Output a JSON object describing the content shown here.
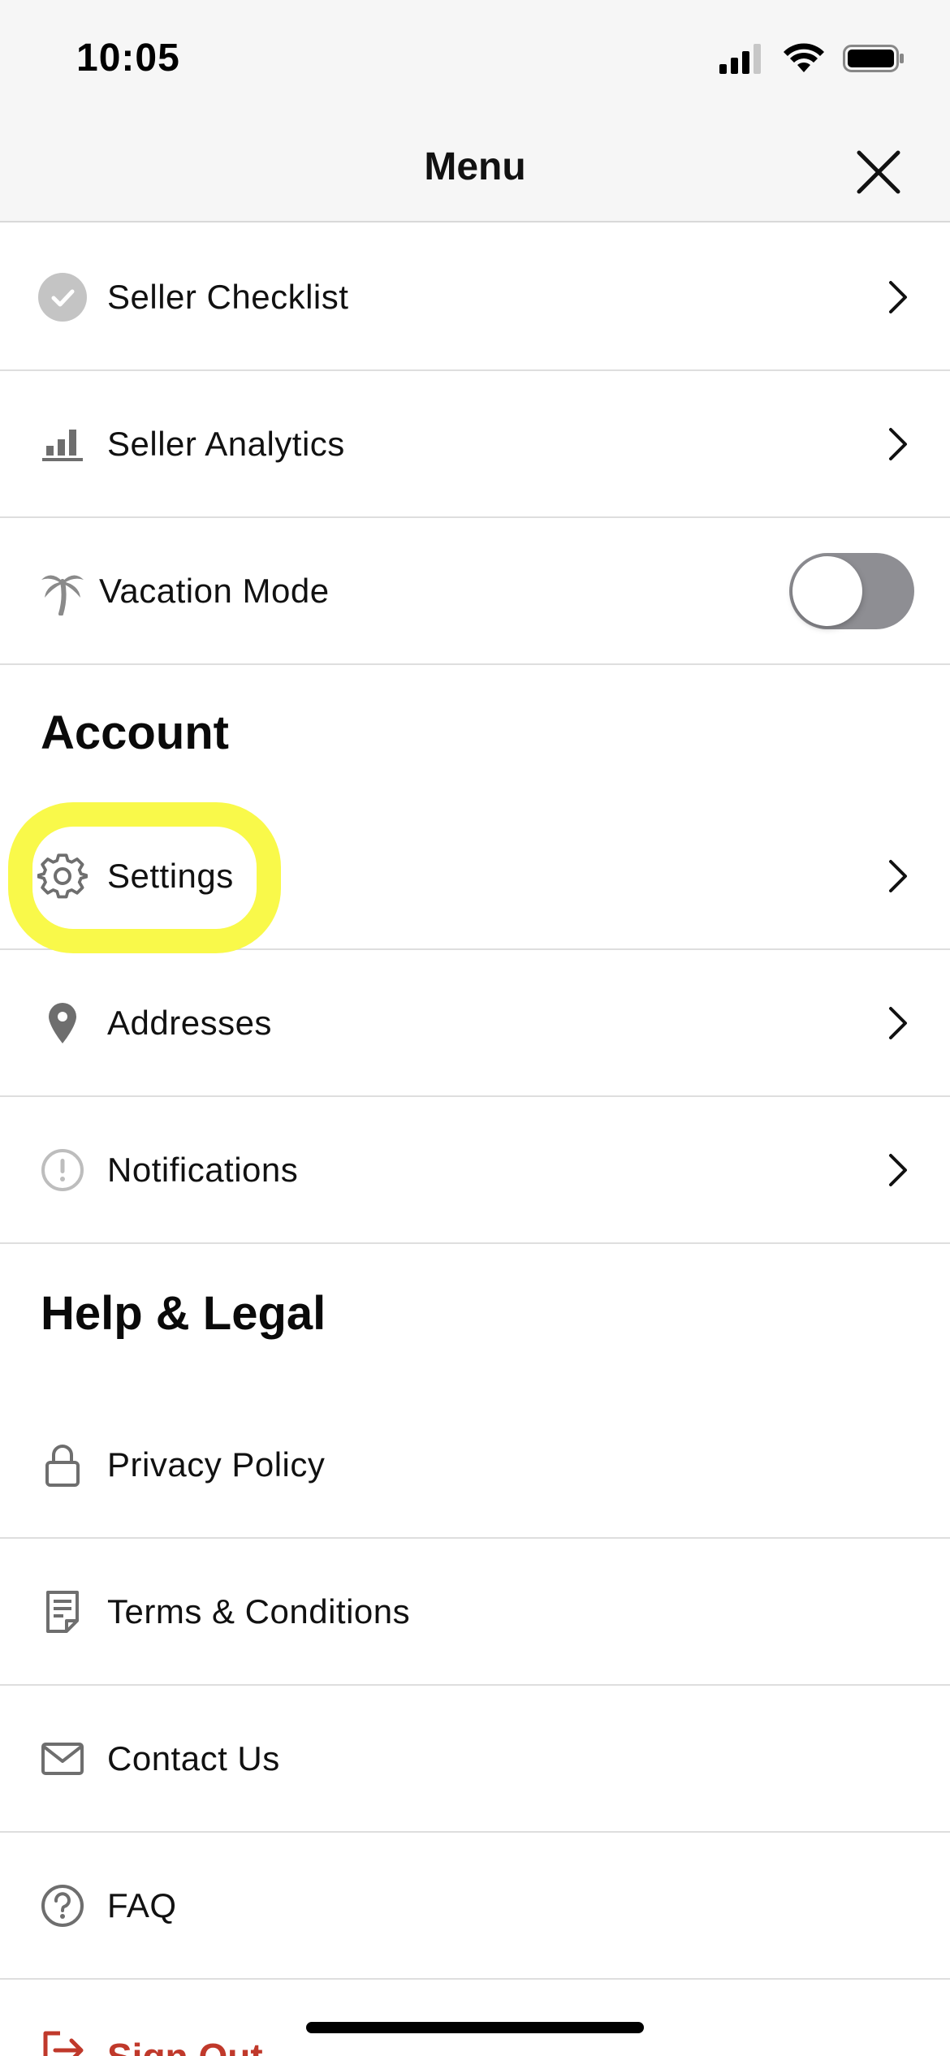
{
  "status_bar": {
    "time": "10:05",
    "icons": [
      "signal-icon",
      "wifi-icon",
      "battery-icon"
    ]
  },
  "header": {
    "title": "Menu",
    "close_icon": "close-icon"
  },
  "seller_items": [
    {
      "label": "Seller Checklist",
      "icon": "check-circle-icon"
    },
    {
      "label": "Seller Analytics",
      "icon": "bar-chart-icon"
    }
  ],
  "vacation": {
    "label": "Vacation Mode",
    "icon": "palm-tree-icon",
    "enabled": false
  },
  "account": {
    "title": "Account",
    "items": [
      {
        "label": "Settings",
        "icon": "gear-icon"
      },
      {
        "label": "Addresses",
        "icon": "location-pin-icon"
      },
      {
        "label": "Notifications",
        "icon": "alert-circle-icon"
      }
    ]
  },
  "help": {
    "title": "Help & Legal",
    "items": [
      {
        "label": "Privacy Policy",
        "icon": "lock-icon"
      },
      {
        "label": "Terms & Conditions",
        "icon": "document-icon"
      },
      {
        "label": "Contact Us",
        "icon": "mail-icon"
      },
      {
        "label": "FAQ",
        "icon": "question-circle-icon"
      }
    ]
  },
  "sign_out": {
    "label": "Sign Out",
    "icon": "sign-out-icon"
  },
  "colors": {
    "highlight": "#f9f94a",
    "sign_out": "#c0392b",
    "toggle_off": "#8e8e93",
    "icon_gray": "#6e6e6e"
  }
}
